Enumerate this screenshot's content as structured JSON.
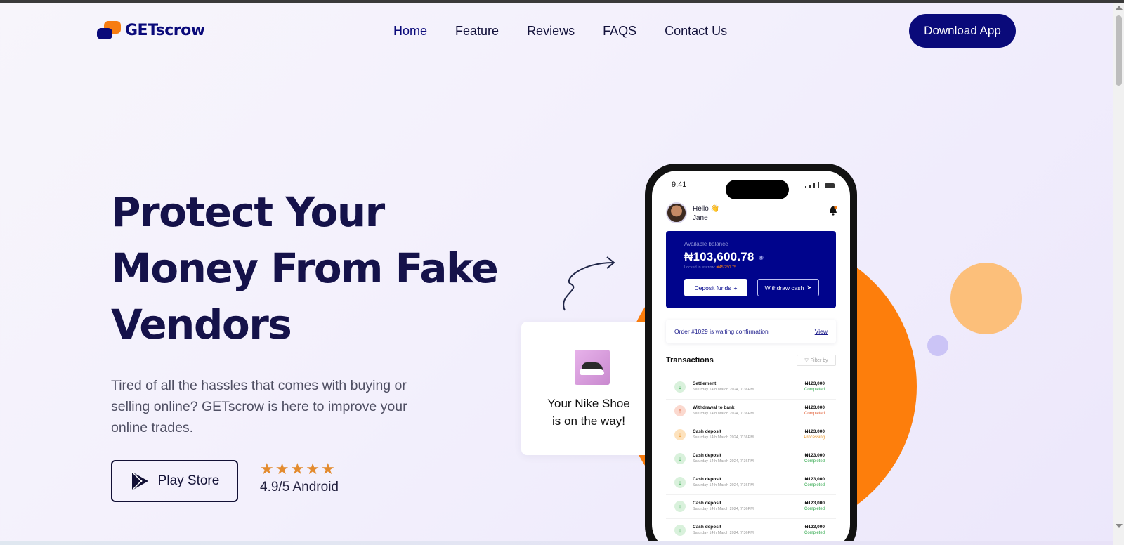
{
  "brand": {
    "name": "GETscrow",
    "colors": {
      "primary": "#0a0a7a",
      "accent": "#fd7e0c"
    }
  },
  "nav": {
    "items": [
      "Home",
      "Feature",
      "Reviews",
      "FAQS",
      "Contact Us"
    ],
    "active": "Home",
    "cta_label": "Download App"
  },
  "hero": {
    "headline_lines": [
      "Protect Your",
      "Money From Fake",
      "Vendors"
    ],
    "subtext": "Tired of all the hassles that comes with buying or selling online? GETscrow is here to improve your online trades.",
    "store_button_label": "Play Store",
    "rating_stars": 5,
    "rating_text": "4.9/5 Android"
  },
  "notification_card": {
    "line1": "Your Nike Shoe",
    "line2": "is on the way!",
    "icon": "shoe-image"
  },
  "phone": {
    "time": "9:41",
    "greeting": "Hello 👋",
    "user_name": "Jane",
    "balance_label": "Available balance",
    "balance_amount": "₦103,600.78",
    "locked_label": "Locked in escrow:",
    "locked_amount": "₦45,250.75",
    "deposit_label": "Deposit funds",
    "withdraw_label": "Withdraw cash",
    "order_text": "Order #1029 is waiting confirmation",
    "order_link": "View",
    "transactions_title": "Transactions",
    "filter_label": "Filter by",
    "transactions": [
      {
        "name": "Settlement",
        "date": "Saturday 14th March 2024, 7:36PM",
        "amount": "₦123,000",
        "status": "Completed",
        "direction": "in",
        "status_color": "green"
      },
      {
        "name": "Withdrawal to bank",
        "date": "Saturday 14th March 2024, 7:36PM",
        "amount": "₦123,000",
        "status": "Completed",
        "direction": "out",
        "status_color": "red"
      },
      {
        "name": "Cash deposit",
        "date": "Saturday 14th March 2024, 7:36PM",
        "amount": "₦123,000",
        "status": "Processing",
        "direction": "pend",
        "status_color": "orange"
      },
      {
        "name": "Cash deposit",
        "date": "Saturday 14th March 2024, 7:36PM",
        "amount": "₦123,000",
        "status": "Completed",
        "direction": "in",
        "status_color": "green"
      },
      {
        "name": "Cash deposit",
        "date": "Saturday 14th March 2024, 7:36PM",
        "amount": "₦123,000",
        "status": "Completed",
        "direction": "in",
        "status_color": "green"
      },
      {
        "name": "Cash deposit",
        "date": "Saturday 14th March 2024, 7:36PM",
        "amount": "₦123,000",
        "status": "Completed",
        "direction": "in",
        "status_color": "green"
      },
      {
        "name": "Cash deposit",
        "date": "Saturday 14th March 2024, 7:36PM",
        "amount": "₦123,000",
        "status": "Completed",
        "direction": "in",
        "status_color": "green"
      }
    ]
  }
}
